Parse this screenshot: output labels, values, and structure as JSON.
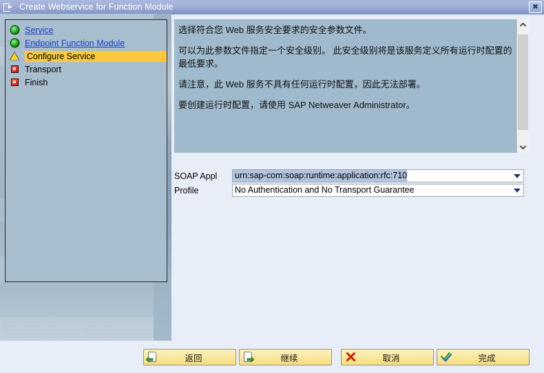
{
  "window": {
    "title": "Create Webservice for Function Module",
    "icon": "window-arrow-icon",
    "close_label": "✖"
  },
  "sidebar": {
    "items": [
      {
        "label": "Service",
        "icon": "green-circle-icon",
        "state": "done",
        "link": true
      },
      {
        "label": "Endpoint Function Module",
        "icon": "green-circle-icon",
        "state": "done",
        "link": true
      },
      {
        "label": "Configure Service",
        "icon": "yellow-warning-triangle-icon",
        "state": "active",
        "link": false
      },
      {
        "label": "Transport",
        "icon": "red-square-icon",
        "state": "pending",
        "link": false
      },
      {
        "label": "Finish",
        "icon": "red-square-icon",
        "state": "pending",
        "link": false
      }
    ]
  },
  "content": {
    "paragraphs": [
      "选择符合您 Web 服务安全要求的安全参数文件。",
      "可以为此参数文件指定一个安全级别。 此安全级别将是该服务定义所有运行时配置的最低要求。",
      "请注意，此 Web 服务不具有任何运行时配置，因此无法部署。",
      "要创建运行时配置，请使用 SAP Netweaver Administrator。"
    ]
  },
  "form": {
    "soap_appl": {
      "label": "SOAP Appl",
      "value": "urn:sap-com:soap:runtime:application:rfc:710",
      "selected": true
    },
    "profile": {
      "label": "Profile",
      "value": "No Authentication and No Transport Guarantee",
      "selected": false
    }
  },
  "buttons": [
    {
      "label": "返回",
      "icon": "page-back-arrow-icon",
      "name": "back-button"
    },
    {
      "label": "继续",
      "icon": "page-forward-arrow-icon",
      "name": "continue-button"
    },
    {
      "label": "取消",
      "icon": "red-x-icon",
      "name": "cancel-button"
    },
    {
      "label": "完成",
      "icon": "double-check-icon",
      "name": "finish-button"
    }
  ],
  "colors": {
    "titlebar": "#9fb0d8",
    "sidebar_panel": "#a8bdcd",
    "content_panel": "#9fbacd",
    "active_highlight": "#ffc73b",
    "link": "#1a41c4",
    "button_face": "#f9e79a",
    "selection": "#b0c4de"
  }
}
